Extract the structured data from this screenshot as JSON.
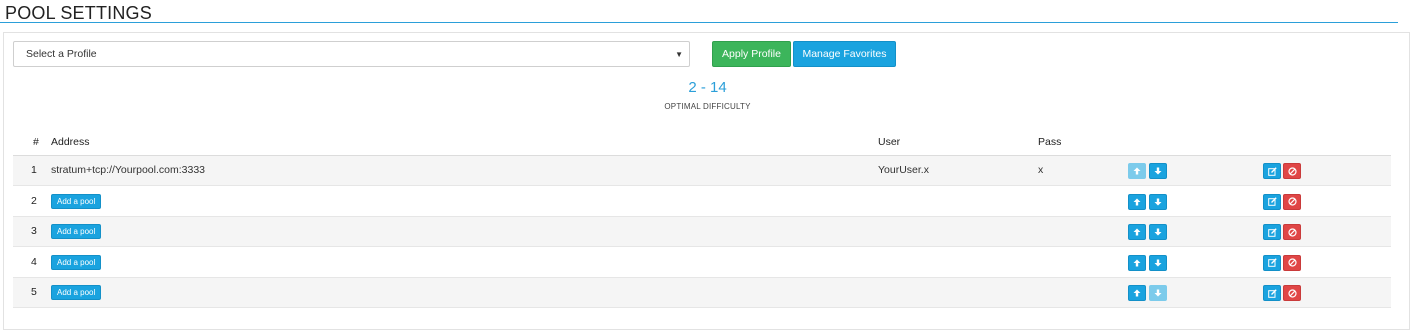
{
  "page": {
    "title": "POOL SETTINGS"
  },
  "profile": {
    "select_placeholder": "Select a Profile",
    "apply_label": "Apply Profile",
    "favorites_label": "Manage Favorites"
  },
  "difficulty": {
    "value": "2 - 14",
    "label": "OPTIMAL DIFFICULTY"
  },
  "table": {
    "headers": {
      "num": "#",
      "address": "Address",
      "user": "User",
      "pass": "Pass"
    },
    "add_pool_label": "Add a pool",
    "rows": [
      {
        "num": "1",
        "address": "stratum+tcp://Yourpool.com:3333",
        "user": "YourUser.x",
        "pass": "x",
        "up_disabled": true,
        "down_disabled": false
      },
      {
        "num": "2",
        "address": "",
        "user": "",
        "pass": "",
        "up_disabled": false,
        "down_disabled": false
      },
      {
        "num": "3",
        "address": "",
        "user": "",
        "pass": "",
        "up_disabled": false,
        "down_disabled": false
      },
      {
        "num": "4",
        "address": "",
        "user": "",
        "pass": "",
        "up_disabled": false,
        "down_disabled": false
      },
      {
        "num": "5",
        "address": "",
        "user": "",
        "pass": "",
        "up_disabled": false,
        "down_disabled": true
      }
    ]
  },
  "colors": {
    "accent": "#2b9fd9",
    "success": "#3cb55b",
    "danger": "#e04646"
  }
}
